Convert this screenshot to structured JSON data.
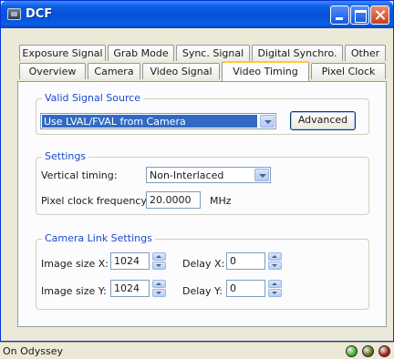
{
  "window": {
    "title": "DCF"
  },
  "tabs_back": [
    "Exposure Signal",
    "Grab Mode",
    "Sync. Signal",
    "Digital Synchro.",
    "Other"
  ],
  "tabs_front": [
    "Overview",
    "Camera",
    "Video Signal",
    "Video Timing",
    "Pixel Clock"
  ],
  "active_tab": "Video Timing",
  "valid_signal_source": {
    "title": "Valid Signal Source",
    "selected": "Use LVAL/FVAL from Camera",
    "advanced_label": "Advanced"
  },
  "settings": {
    "title": "Settings",
    "vertical_timing_label": "Vertical timing:",
    "vertical_timing_value": "Non-Interlaced",
    "pixel_clock_label": "Pixel clock frequency:",
    "pixel_clock_value": "20.0000",
    "pixel_clock_unit": "MHz"
  },
  "camera_link": {
    "title": "Camera Link Settings",
    "image_size_x_label": "Image size X:",
    "image_size_x_value": "1024",
    "delay_x_label": "Delay X:",
    "delay_x_value": "0",
    "image_size_y_label": "Image size Y:",
    "image_size_y_value": "1024",
    "delay_y_label": "Delay Y:",
    "delay_y_value": "0"
  },
  "status": {
    "text": "On Odyssey",
    "leds": [
      "#3fae2a",
      "#5e6b22",
      "#a01d14"
    ]
  }
}
